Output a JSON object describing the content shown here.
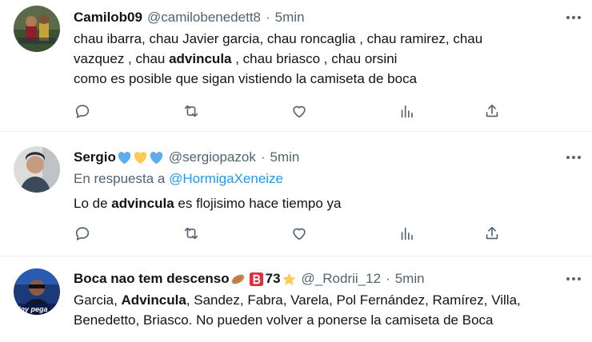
{
  "colors": {
    "text": "#0f1419",
    "secondary": "#536471",
    "link": "#1d9bf0",
    "divider": "#eff3f4"
  },
  "tweets": [
    {
      "name": "Camilob09",
      "handle": "@camilobenedett8",
      "separator": "·",
      "time": "5min",
      "line1": "chau ibarra, chau Javier garcia,  chau roncaglia , chau ramirez,  chau",
      "line2_pre": "vazquez , chau ",
      "line2_bold": "advincula",
      "line2_post": " , chau briasco , chau orsini",
      "line3": "como es posible que sigan vistiendo la camiseta de boca"
    },
    {
      "name": "Sergio",
      "name_emojis": [
        "blue-heart",
        "yellow-heart",
        "blue-heart"
      ],
      "handle": "@sergiopazok",
      "separator": "·",
      "time": "5min",
      "reply_prefix": "En respuesta a ",
      "reply_mention": "@HormigaXeneize",
      "text_pre": "Lo de ",
      "text_bold": "advincula",
      "text_post": " es flojisimo hace tiempo ya"
    },
    {
      "name": "Boca nao tem descenso",
      "name_emojis": [
        "peanut",
        "letter-b-button"
      ],
      "name_suffix": " 73",
      "name_suffix_emoji": "star",
      "handle": "@_Rodrii_12",
      "separator": "·",
      "time": "5min",
      "avatar_caption": "Hoy pega",
      "line1_pre": "Garcia, ",
      "line1_bold": "Advincula",
      "line1_post": ", Sandez, Fabra, Varela, Pol Fernández, Ramírez, Villa,",
      "line2": "Benedetto, Briasco. No pueden volver a ponerse la camiseta de Boca"
    }
  ]
}
